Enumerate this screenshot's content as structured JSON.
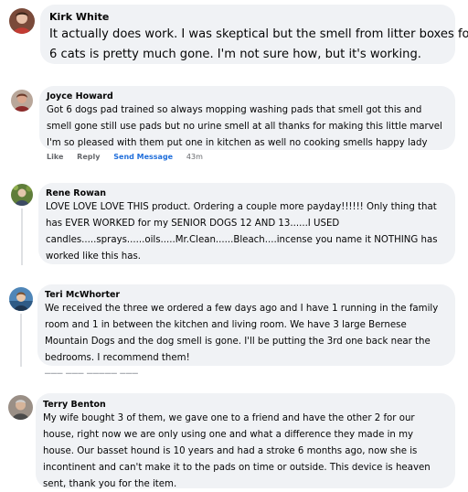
{
  "comments": [
    {
      "author": "Kirk White",
      "lines": [
        "It actually does work. I was skeptical but the smell from litter boxes for",
        "6 cats is pretty much gone. I'm not sure how, but it's working."
      ]
    },
    {
      "author": "Joyce Howard",
      "lines": [
        "Got 6 dogs pad trained so always mopping washing pads that smell got this and",
        "smell gone still use pads but no urine smell at all thanks for making this little marvel",
        "I'm so pleased with them put one in kitchen as well no cooking smells happy lady"
      ],
      "actions": {
        "like": "Like",
        "reply": "Reply",
        "send_message": "Send Message",
        "time": "43m"
      }
    },
    {
      "author": "Rene Rowan",
      "lines": [
        "LOVE LOVE LOVE THIS product. Ordering a couple more payday!!!!!! Only thing that",
        "has EVER WORKED for my SENIOR DOGS 12 AND 13......I USED",
        "candles.....sprays......oils.....Mr.Clean......Bleach....incense you name it NOTHING has",
        "worked like this has."
      ]
    },
    {
      "author": "Teri McWhorter",
      "lines": [
        "We received the three we ordered a few days ago and I have 1 running in the family",
        "room and 1 in between the kitchen and living room. We have 3 large Bernese",
        "Mountain Dogs and the dog smell is gone. I'll be putting the 3rd one back near the",
        "bedrooms. I recommend them!"
      ]
    },
    {
      "author": "Terry Benton",
      "lines": [
        "My wife bought 3 of them, we gave one to a friend and have the other 2 for our",
        "house, right now we are only using one and what a difference they made in my",
        "house. Our basset hound is 10 years and had a stroke 6 months ago, now she is",
        "incontinent and can't make it to the pads on time or outside. This device is heaven",
        "sent, thank you for the item."
      ]
    }
  ],
  "colors": {
    "bubble": "#f0f2f5",
    "link": "#216fdb",
    "muted": "#65676b"
  }
}
